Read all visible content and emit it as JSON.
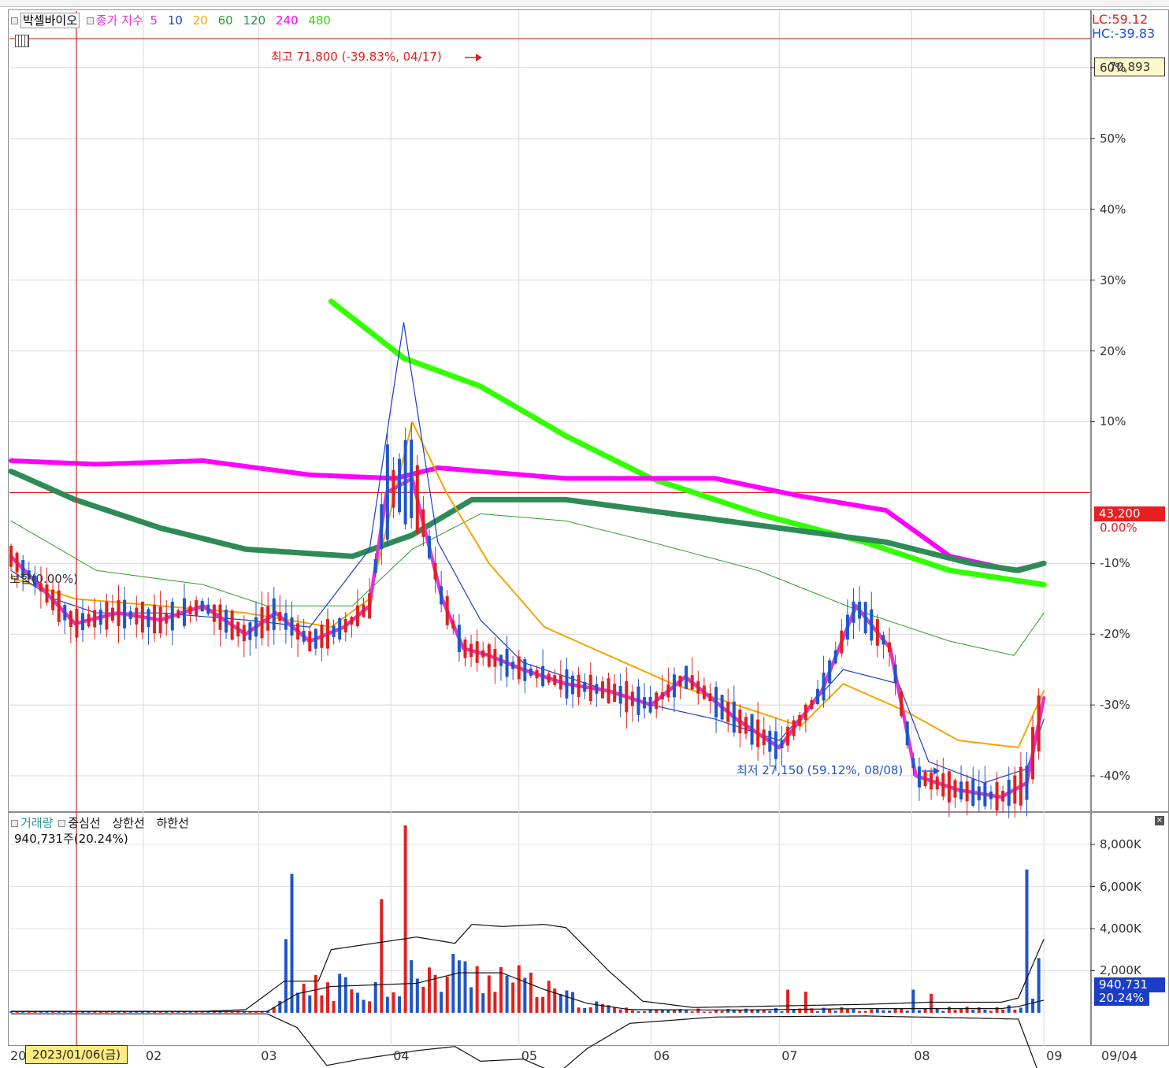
{
  "stock": {
    "name": "박셀바이오",
    "indicator_label": "종가 지수",
    "ma_periods": [
      "5",
      "10",
      "20",
      "60",
      "120",
      "240",
      "480"
    ],
    "ma_colors": [
      "#e632d2",
      "#1e3cc8",
      "#f5a500",
      "#28a028",
      "#2e8b57",
      "#ff00ff",
      "#33ff00"
    ],
    "lc_text": "LC:59.12",
    "hc_text": "HC:-39.83",
    "top_price_box": "70,893",
    "current_price_box": "43,200",
    "current_pct": "0.00%",
    "max_annotation": "최고 71,800 (-39.83%, 04/17)",
    "min_annotation": "최저 27,150 (59.12%, 08/08)",
    "reference_label": "보합(0.00%)",
    "up_color": "#e02020",
    "down_color": "#1f55c8"
  },
  "volume": {
    "title": "거래량",
    "legend_items": [
      "중심선",
      "상한선",
      "하한선"
    ],
    "value_text": "940,731주(20.24%)",
    "current_box": "940,731",
    "current_pct_box": "20.24%"
  },
  "date_axis": {
    "first_label": "20",
    "cursor_date": "2023/01/06(금)",
    "last_date": "09/04"
  },
  "chart_data": [
    {
      "type": "candlestick",
      "title": "박셀바이오",
      "y_scale": "percent change vs current close",
      "y_ticks": [
        "60%",
        "50%",
        "40%",
        "30%",
        "20%",
        "10%",
        "0.00%",
        "-10%",
        "-20%",
        "-30%",
        "-40%"
      ],
      "y_tick_values": [
        60,
        50,
        40,
        30,
        20,
        10,
        0,
        -10,
        -20,
        -30,
        -40
      ],
      "ylim": [
        -45,
        68
      ],
      "x_ticks": [
        "20",
        "02",
        "03",
        "04",
        "05",
        "06",
        "07",
        "08",
        "09"
      ],
      "x_tick_days": [
        0,
        31,
        58,
        89,
        119,
        150,
        180,
        211,
        242
      ],
      "reference_lines": [
        {
          "label": "0.00%",
          "value": 0
        },
        {
          "label": "70,893",
          "value": 64.1
        }
      ],
      "max": {
        "value": 71800,
        "pct": -39.83,
        "date": "04/17"
      },
      "min": {
        "value": 27150,
        "pct": 59.12,
        "date": "08/08"
      },
      "current": 43200,
      "series": [
        {
          "name": "5",
          "points": [
            [
              0,
              -9
            ],
            [
              8,
              -14
            ],
            [
              15,
              -18.5
            ],
            [
              25,
              -17
            ],
            [
              35,
              -18
            ],
            [
              45,
              -16
            ],
            [
              55,
              -20
            ],
            [
              62,
              -17
            ],
            [
              70,
              -21
            ],
            [
              78,
              -19
            ],
            [
              84,
              -16
            ],
            [
              88,
              0
            ],
            [
              94,
              2
            ],
            [
              101,
              -15
            ],
            [
              106,
              -22
            ],
            [
              112,
              -23
            ],
            [
              120,
              -25
            ],
            [
              130,
              -27
            ],
            [
              140,
              -28
            ],
            [
              150,
              -30
            ],
            [
              158,
              -26
            ],
            [
              170,
              -32
            ],
            [
              180,
              -36
            ],
            [
              190,
              -28
            ],
            [
              198,
              -16
            ],
            [
              206,
              -22
            ],
            [
              212,
              -40
            ],
            [
              222,
              -42
            ],
            [
              232,
              -43
            ],
            [
              238,
              -41
            ],
            [
              242,
              -29
            ]
          ]
        },
        {
          "name": "10",
          "points": [
            [
              0,
              -11
            ],
            [
              10,
              -15
            ],
            [
              20,
              -17
            ],
            [
              35,
              -17
            ],
            [
              55,
              -18
            ],
            [
              70,
              -19
            ],
            [
              84,
              -8
            ],
            [
              92,
              24
            ],
            [
              100,
              -7
            ],
            [
              110,
              -18
            ],
            [
              120,
              -24
            ],
            [
              135,
              -27
            ],
            [
              150,
              -30
            ],
            [
              165,
              -32
            ],
            [
              180,
              -35
            ],
            [
              195,
              -25
            ],
            [
              208,
              -27
            ],
            [
              215,
              -38
            ],
            [
              228,
              -41
            ],
            [
              238,
              -39
            ],
            [
              242,
              -32
            ]
          ]
        },
        {
          "name": "20",
          "points": [
            [
              0,
              -12
            ],
            [
              15,
              -15
            ],
            [
              35,
              -16
            ],
            [
              55,
              -17
            ],
            [
              75,
              -19
            ],
            [
              84,
              -15
            ],
            [
              94,
              10
            ],
            [
              102,
              0
            ],
            [
              112,
              -10
            ],
            [
              125,
              -19
            ],
            [
              140,
              -23
            ],
            [
              155,
              -27
            ],
            [
              170,
              -30
            ],
            [
              185,
              -33
            ],
            [
              195,
              -27
            ],
            [
              210,
              -31
            ],
            [
              222,
              -35
            ],
            [
              236,
              -36
            ],
            [
              242,
              -28
            ]
          ]
        },
        {
          "name": "60",
          "points": [
            [
              0,
              -4
            ],
            [
              20,
              -11
            ],
            [
              45,
              -13
            ],
            [
              60,
              -16
            ],
            [
              80,
              -16
            ],
            [
              94,
              -8
            ],
            [
              110,
              -3
            ],
            [
              130,
              -4
            ],
            [
              150,
              -7
            ],
            [
              175,
              -11
            ],
            [
              200,
              -17
            ],
            [
              220,
              -21
            ],
            [
              235,
              -23
            ],
            [
              242,
              -17
            ]
          ]
        },
        {
          "name": "120",
          "points": [
            [
              0,
              3
            ],
            [
              15,
              -1
            ],
            [
              35,
              -5
            ],
            [
              55,
              -8
            ],
            [
              80,
              -9
            ],
            [
              94,
              -6
            ],
            [
              108,
              -1
            ],
            [
              130,
              -1
            ],
            [
              155,
              -3
            ],
            [
              180,
              -5
            ],
            [
              205,
              -7
            ],
            [
              225,
              -10
            ],
            [
              236,
              -11
            ],
            [
              242,
              -10
            ]
          ]
        },
        {
          "name": "240",
          "points": [
            [
              0,
              4.5
            ],
            [
              20,
              4
            ],
            [
              45,
              4.5
            ],
            [
              70,
              2.5
            ],
            [
              90,
              2
            ],
            [
              100,
              3.5
            ],
            [
              130,
              2
            ],
            [
              165,
              2
            ],
            [
              185,
              -0.5
            ],
            [
              205,
              -2.5
            ],
            [
              220,
              -9
            ],
            [
              235,
              -11
            ],
            [
              242,
              -10
            ]
          ]
        },
        {
          "name": "480",
          "points": [
            [
              75,
              27
            ],
            [
              92,
              19
            ],
            [
              110,
              15
            ],
            [
              130,
              8
            ],
            [
              150,
              2
            ],
            [
              175,
              -3
            ],
            [
              200,
              -7
            ],
            [
              220,
              -11
            ],
            [
              242,
              -13
            ]
          ]
        }
      ]
    },
    {
      "type": "bar",
      "title": "거래량",
      "y_ticks": [
        "8,000K",
        "6,000K",
        "4,000K",
        "2,000K"
      ],
      "y_tick_values": [
        8000,
        6000,
        4000,
        2000
      ],
      "ylim": [
        -1500,
        9500
      ],
      "current": 940.7,
      "series": [
        {
          "name": "중심선",
          "points": [
            [
              0,
              60
            ],
            [
              60,
              60
            ],
            [
              67,
              900
            ],
            [
              75,
              1250
            ],
            [
              95,
              1400
            ],
            [
              105,
              1900
            ],
            [
              115,
              1900
            ],
            [
              125,
              1100
            ],
            [
              135,
              450
            ],
            [
              145,
              150
            ],
            [
              170,
              130
            ],
            [
              200,
              200
            ],
            [
              225,
              200
            ],
            [
              232,
              200
            ],
            [
              236,
              300
            ],
            [
              242,
              600
            ]
          ]
        },
        {
          "name": "상한선",
          "points": [
            [
              0,
              70
            ],
            [
              45,
              70
            ],
            [
              55,
              150
            ],
            [
              64,
              1500
            ],
            [
              72,
              1500
            ],
            [
              75,
              3000
            ],
            [
              85,
              3300
            ],
            [
              95,
              3600
            ],
            [
              104,
              3300
            ],
            [
              108,
              4200
            ],
            [
              115,
              4100
            ],
            [
              125,
              4200
            ],
            [
              130,
              4050
            ],
            [
              140,
              2000
            ],
            [
              148,
              550
            ],
            [
              160,
              250
            ],
            [
              200,
              400
            ],
            [
              215,
              500
            ],
            [
              232,
              500
            ],
            [
              236,
              700
            ],
            [
              242,
              3500
            ]
          ]
        },
        {
          "name": "하한선",
          "points": [
            [
              0,
              -50
            ],
            [
              60,
              -50
            ],
            [
              67,
              -700
            ],
            [
              74,
              -2500
            ],
            [
              82,
              -2200
            ],
            [
              95,
              -1800
            ],
            [
              104,
              -1600
            ],
            [
              110,
              -2300
            ],
            [
              120,
              -2200
            ],
            [
              128,
              -2900
            ],
            [
              135,
              -1700
            ],
            [
              145,
              -500
            ],
            [
              165,
              -200
            ],
            [
              200,
              -150
            ],
            [
              225,
              -250
            ],
            [
              236,
              -300
            ],
            [
              242,
              -3500
            ]
          ]
        }
      ]
    }
  ]
}
